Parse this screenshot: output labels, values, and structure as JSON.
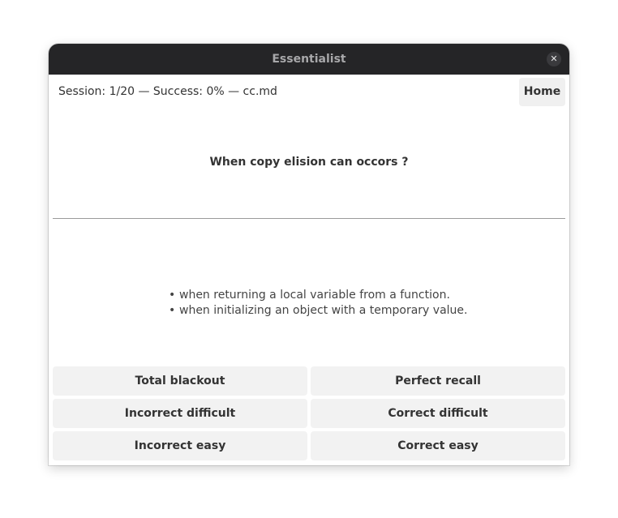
{
  "window": {
    "title": "Essentialist",
    "close_glyph": "✕",
    "close_icon": "close-icon"
  },
  "header": {
    "status": "Session: 1/20 — Success: 0% — cc.md",
    "home_label": "Home"
  },
  "card": {
    "question": "When copy elision can occors ?",
    "answer_items": [
      "when returning a local variable from a function.",
      "when initializing an object with a temporary value."
    ]
  },
  "grades": {
    "total_blackout": "Total blackout",
    "perfect_recall": "Perfect recall",
    "incorrect_difficult": "Incorrect difficult",
    "correct_difficult": "Correct difficult",
    "incorrect_easy": "Incorrect easy",
    "correct_easy": "Correct easy"
  },
  "colors": {
    "titlebar_bg": "#252527",
    "button_bg": "#f2f2f2",
    "text": "#333333"
  }
}
